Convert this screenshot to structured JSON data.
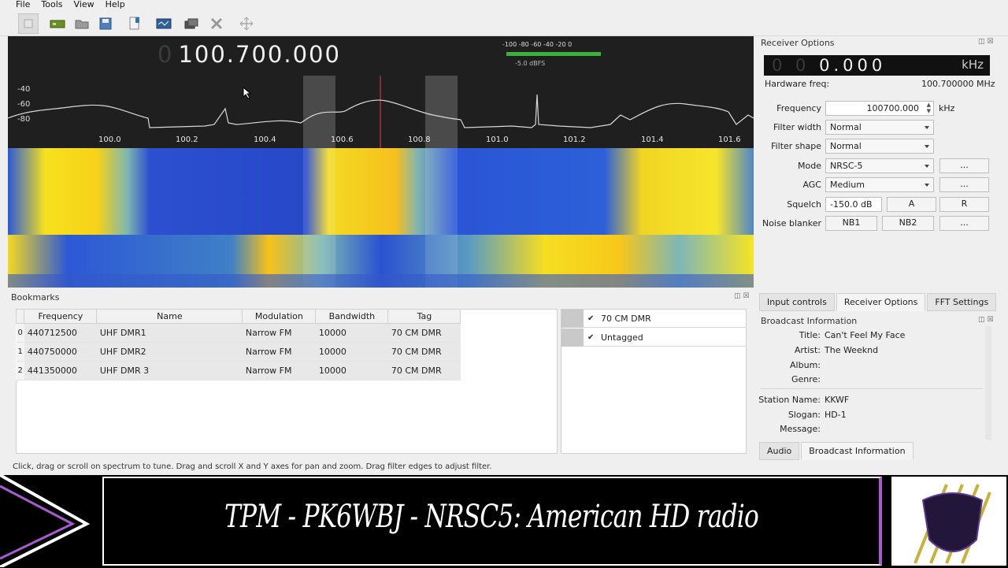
{
  "menu": [
    "File",
    "Tools",
    "View",
    "Help"
  ],
  "toolbar_icons": [
    "power-icon",
    "device-icon",
    "folder-icon",
    "save-icon",
    "record-icon",
    "screenshot-icon",
    "network-icon",
    "tools-icon",
    "crosshair-icon"
  ],
  "spectrum": {
    "freq_dim": "0",
    "freq_main": "100.700.000",
    "meter_scale": "-100  -80  -60  -40  -20   0",
    "meter_label": "-5.0 dBFS",
    "db_labels": [
      "-40",
      "-60",
      "-80"
    ],
    "x_ticks": [
      "100.0",
      "100.2",
      "100.4",
      "100.6",
      "100.8",
      "101.0",
      "101.2",
      "101.4",
      "101.6"
    ]
  },
  "receiver": {
    "title": "Receiver Options",
    "lcd_dim": "0 0",
    "lcd_value": "0.000",
    "lcd_unit": "kHz",
    "hw_label": "Hardware freq:",
    "hw_value": "100.700000 MHz",
    "frequency_label": "Frequency",
    "frequency_value": "100700.000",
    "frequency_unit": "kHz",
    "filter_width_label": "Filter width",
    "filter_width_value": "Normal",
    "filter_shape_label": "Filter shape",
    "filter_shape_value": "Normal",
    "mode_label": "Mode",
    "mode_value": "NRSC-5",
    "agc_label": "AGC",
    "agc_value": "Medium",
    "squelch_label": "Squelch",
    "squelch_value": "-150.0 dB",
    "squelch_a": "A",
    "squelch_r": "R",
    "noise_label": "Noise blanker",
    "nb1": "NB1",
    "nb2": "NB2",
    "more": "..."
  },
  "tabs_top": [
    "Input controls",
    "Receiver Options",
    "FFT Settings"
  ],
  "broadcast": {
    "title": "Broadcast Information",
    "title_key": "Title:",
    "title_val": "Can't Feel My Face",
    "artist_key": "Artist:",
    "artist_val": "The Weeknd",
    "album_key": "Album:",
    "album_val": "",
    "genre_key": "Genre:",
    "genre_val": "",
    "station_key": "Station Name:",
    "station_val": "KKWF",
    "slogan_key": "Slogan:",
    "slogan_val": "HD-1",
    "message_key": "Message:",
    "message_val": ""
  },
  "tabs_bottom": [
    "Audio",
    "Broadcast Information"
  ],
  "bookmarks": {
    "title": "Bookmarks",
    "columns": [
      "Frequency",
      "Name",
      "Modulation",
      "Bandwidth",
      "Tag"
    ],
    "rows": [
      {
        "idx": "0",
        "freq": "440712500",
        "name": "UHF DMR1",
        "mod": "Narrow FM",
        "bw": "10000",
        "tag": "70 CM DMR"
      },
      {
        "idx": "1",
        "freq": "440750000",
        "name": "UHF DMR2",
        "mod": "Narrow FM",
        "bw": "10000",
        "tag": "70 CM DMR"
      },
      {
        "idx": "2",
        "freq": "441350000",
        "name": "UHF DMR 3",
        "mod": "Narrow FM",
        "bw": "10000",
        "tag": "70 CM DMR"
      }
    ],
    "tags": [
      "70 CM DMR",
      "Untagged"
    ]
  },
  "status": "Click, drag or scroll on spectrum to tune. Drag and scroll X and Y axes for pan and zoom. Drag filter edges to adjust filter.",
  "banner": {
    "text": "TPM - PK6WBJ - NRSC5: American HD radio"
  },
  "colors": {
    "accent_purple": "#a85bd0",
    "meter_green": "#3ab33a",
    "waterfall_blue": "#2a4fd0",
    "waterfall_yellow": "#f5e21a"
  }
}
